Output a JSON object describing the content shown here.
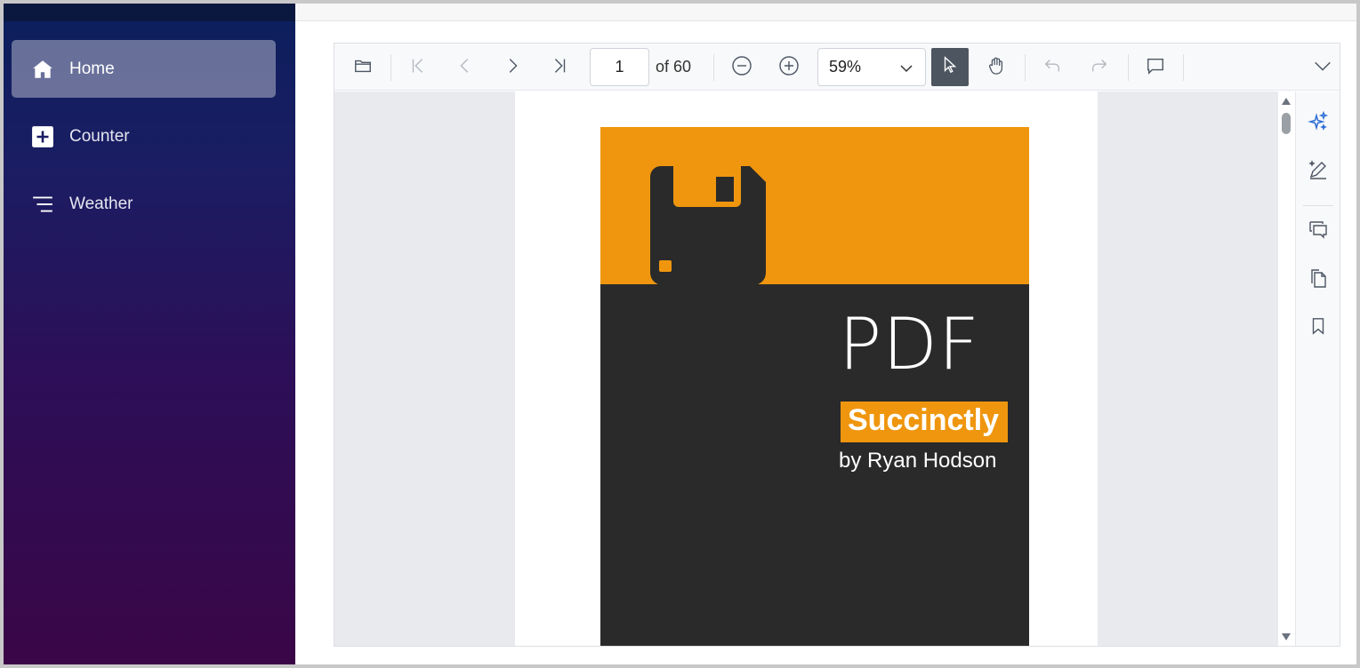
{
  "sidebar": {
    "items": [
      {
        "label": "Home",
        "icon": "home-icon",
        "active": true
      },
      {
        "label": "Counter",
        "icon": "plus-icon",
        "active": false
      },
      {
        "label": "Weather",
        "icon": "list-icon",
        "active": false
      }
    ]
  },
  "toolbar": {
    "current_page": "1",
    "page_of": "of 60",
    "zoom": "59%",
    "icons": [
      "open-file-icon",
      "first-page-icon",
      "previous-page-icon",
      "next-page-icon",
      "last-page-icon",
      "zoom-out-icon",
      "zoom-in-icon",
      "zoom-dropdown-chevron-icon",
      "selection-pointer-icon",
      "pan-hand-icon",
      "undo-icon",
      "redo-icon",
      "comment-icon",
      "more-options-chevron-icon"
    ]
  },
  "document": {
    "cover_title": "PDF",
    "cover_series": "Succinctly",
    "cover_author": "by Ryan Hodson"
  },
  "right_panel": {
    "icons": [
      "smart-pdf-sparkle-icon",
      "edit-annotation-icon",
      "comments-panel-icon",
      "page-thumbnails-icon",
      "bookmarks-icon"
    ]
  },
  "colors": {
    "accent_orange": "#ef960e",
    "cover_dark": "#2a2a2a",
    "sidebar_top": "#0b1f5c",
    "sidebar_bottom": "#3a0647",
    "sparkle_blue": "#2f6fd6"
  }
}
